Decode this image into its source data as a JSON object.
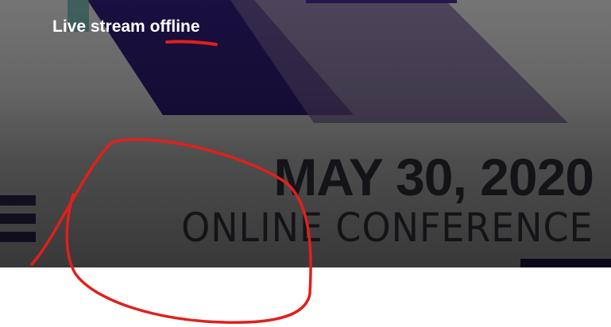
{
  "banner": {
    "date": "MAY 30, 2020",
    "subtitle": "ONLINE CONFERENCE"
  },
  "stream": {
    "status_prefix": "Live stream",
    "status_word": "offline"
  },
  "colors": {
    "accent_dark": "#2b1a6e",
    "accent_light": "#6b5a8c",
    "annotation": "#e0201c",
    "status_text": "#ffffff"
  },
  "annotation": {
    "type": "hand-drawn red ink: underline and loop"
  }
}
